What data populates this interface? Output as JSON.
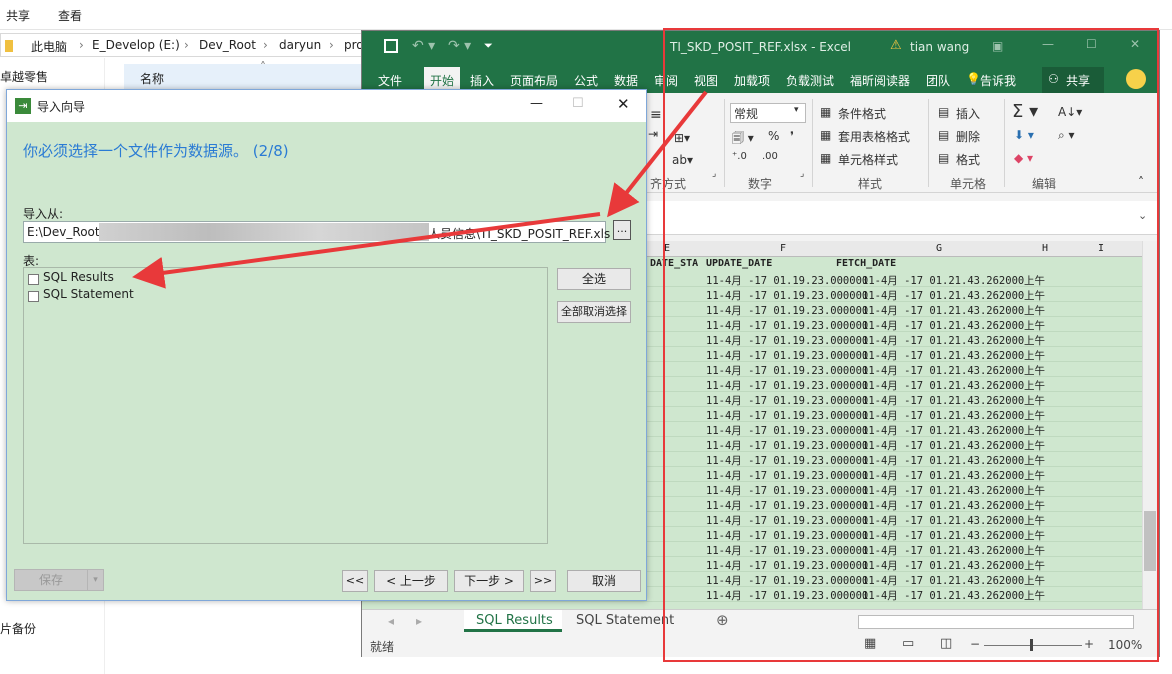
{
  "explorer": {
    "ribbon": {
      "share": "共享",
      "view": "查看"
    },
    "address": [
      "此电脑",
      "E_Develop (E:)",
      "Dev_Root",
      "daryun",
      "pro"
    ],
    "header_name": "名称",
    "nav_items": {
      "retail": "卓越零售",
      "photo_backup": "片备份"
    }
  },
  "excel": {
    "title": "TI_SKD_POSIT_REF.xlsx - Excel",
    "user": "tian wang",
    "tabs": [
      "文件",
      "开始",
      "插入",
      "页面布局",
      "公式",
      "数据",
      "审阅",
      "视图",
      "加载项",
      "负载测试",
      "福昕阅读器",
      "团队"
    ],
    "tell_me": "告诉我",
    "share": "共享",
    "ribbon": {
      "number_format": "常规",
      "conditional_format": "条件格式",
      "table_format": "套用表格格式",
      "cell_style": "单元格样式",
      "insert": "插入",
      "delete": "删除",
      "format": "格式",
      "group_align": "齐方式",
      "group_number": "数字",
      "group_style": "样式",
      "group_cells": "单元格",
      "group_edit": "编辑"
    },
    "columns": [
      "E",
      "F",
      "G",
      "H",
      "I"
    ],
    "fields": {
      "e": "DATE_STA",
      "f": "UPDATE_DATE",
      "g": "FETCH_DATE"
    },
    "row_values": {
      "update": "11-4月 -17 01.19.23.000000",
      "fetch": "11-4月 -17 01.21.43.262000",
      "ampm": "上午"
    },
    "row_count": 22,
    "sheets": [
      "SQL Results",
      "SQL Statement"
    ],
    "status": "就绪",
    "zoom": "100%"
  },
  "dialog": {
    "title": "导入向导",
    "heading": "你必须选择一个文件作为数据源。 (2/8)",
    "import_from_label": "导入从:",
    "path_start": "E:\\Dev_Root\\c",
    "path_end": "人员信息\\TI_SKD_POSIT_REF.xls",
    "browse": "...",
    "table_label": "表:",
    "tables": [
      "SQL Results",
      "SQL Statement"
    ],
    "select_all": "全选",
    "deselect_all": "全部取消选择",
    "save": "保存",
    "first": "<<",
    "prev": "< 上一步",
    "next": "下一步 >",
    "last": ">>",
    "cancel": "取消"
  },
  "colors": {
    "excel_green": "#217346",
    "annotation_red": "#e8393a",
    "dialog_heading": "#2a7bd4"
  }
}
